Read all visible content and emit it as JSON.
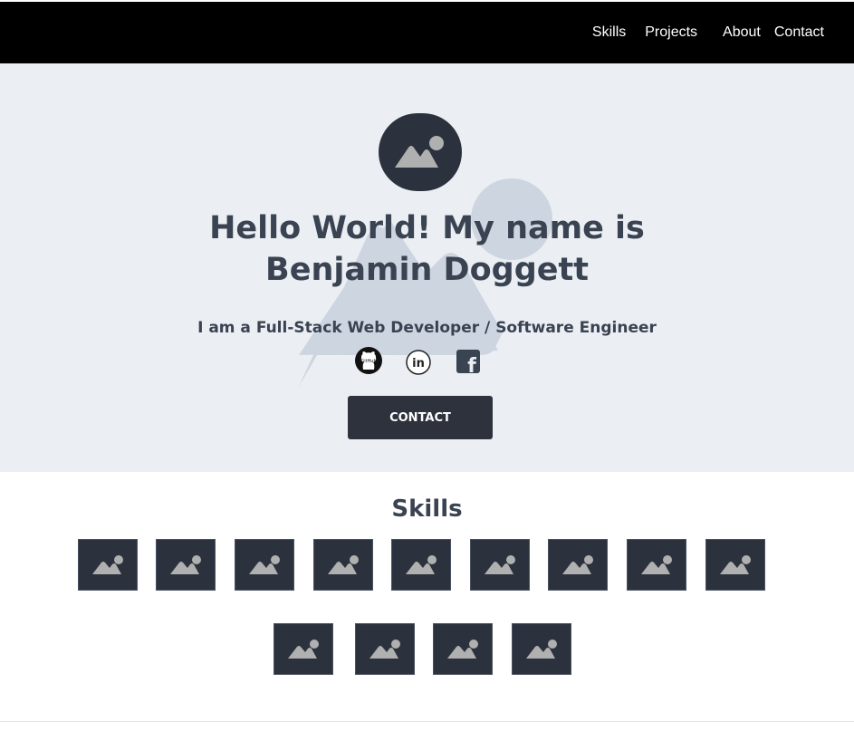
{
  "nav": {
    "items": [
      {
        "label": "Skills"
      },
      {
        "label": "Projects"
      },
      {
        "label": "About"
      },
      {
        "label": "Contact"
      }
    ]
  },
  "hero": {
    "title_line1": "Hello World! My name is",
    "title_line2": "Benjamin Doggett",
    "subtitle": "I am a Full-Stack Web Developer / Software Engineer",
    "contact_button": "CONTACT",
    "social": [
      {
        "icon": "github-icon",
        "label": "GitHub"
      },
      {
        "icon": "linkedin-icon",
        "label": "in"
      },
      {
        "icon": "facebook-icon",
        "label": "f"
      }
    ]
  },
  "skills": {
    "heading": "Skills",
    "tile_count": 13
  },
  "colors": {
    "navbar": "#000000",
    "hero_bg": "#ebeef3",
    "text_dark": "#3a4352",
    "button": "#2d323d",
    "tile": "#2c323d"
  }
}
